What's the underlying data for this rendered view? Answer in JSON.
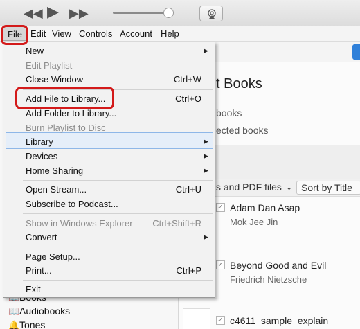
{
  "toolbar": {
    "icons": [
      "rewind-icon",
      "play-icon",
      "fast-forward-icon",
      "volume-slider",
      "airplay-icon"
    ]
  },
  "menubar": {
    "file": "File",
    "edit": "Edit",
    "view": "View",
    "controls": "Controls",
    "account": "Account",
    "help": "Help"
  },
  "file_menu": {
    "new": "New",
    "edit_playlist": "Edit Playlist",
    "close_window": "Close Window",
    "close_window_sc": "Ctrl+W",
    "add_file": "Add File to Library...",
    "add_file_sc": "Ctrl+O",
    "add_folder": "Add Folder to Library...",
    "burn_playlist": "Burn Playlist to Disc",
    "library": "Library",
    "devices": "Devices",
    "home_sharing": "Home Sharing",
    "open_stream": "Open Stream...",
    "open_stream_sc": "Ctrl+U",
    "subscribe_podcast": "Subscribe to Podcast...",
    "show_explorer": "Show in Windows Explorer",
    "show_explorer_sc": "Ctrl+Shift+R",
    "convert": "Convert",
    "page_setup": "Page Setup...",
    "print": "Print...",
    "print_sc": "Ctrl+P",
    "exit": "Exit"
  },
  "sidebar": {
    "books": "Books",
    "audiobooks": "Audiobooks",
    "tones": "Tones"
  },
  "main": {
    "title_partial": "t Books",
    "line1_partial": "books",
    "line2_partial": "ected books",
    "filter_partial": "s and PDF files",
    "sort": "Sort by Title",
    "books": [
      {
        "title": "Adam Dan Asap",
        "author": "Mok Jee Jin"
      },
      {
        "title": "Beyond Good and Evil",
        "author": "Friedrich Nietzsche"
      },
      {
        "title": "c4611_sample_explain",
        "author": ""
      }
    ]
  },
  "colors": {
    "highlight_red": "#d31a1a",
    "accent_blue": "#2f80d9"
  }
}
